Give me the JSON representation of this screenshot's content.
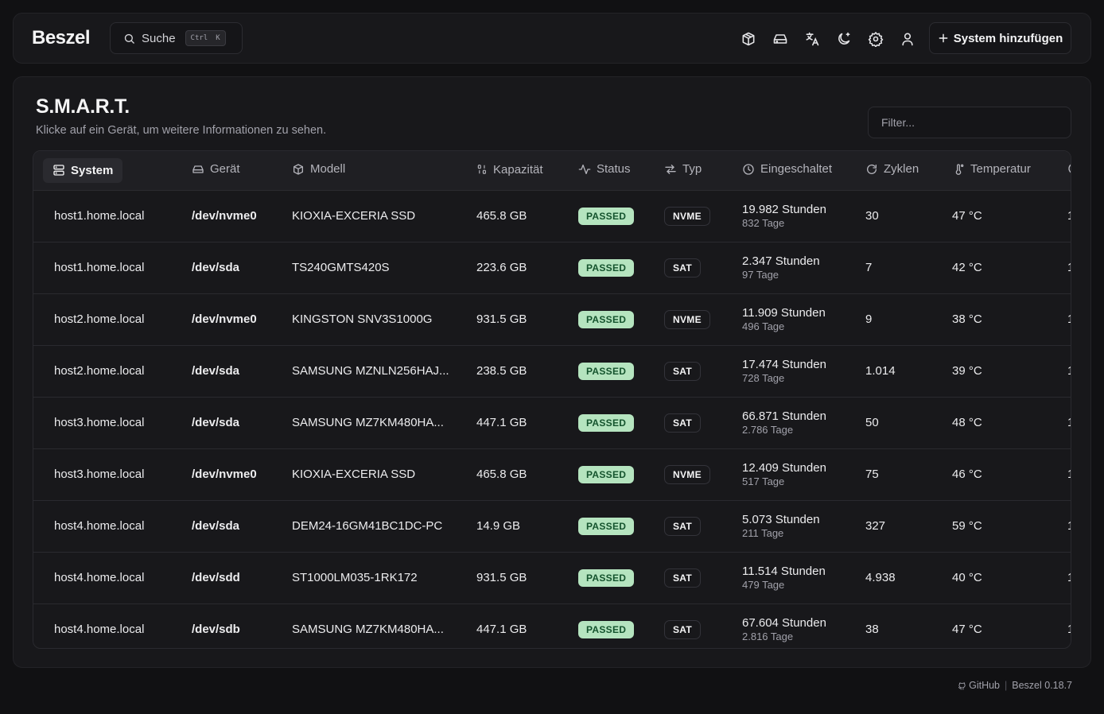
{
  "app": {
    "logo": "Beszel",
    "version": "Beszel 0.18.7"
  },
  "search": {
    "label": "Suche",
    "kbd_1": "Ctrl",
    "kbd_2": "K"
  },
  "header_icons": [
    "container-icon",
    "drive-icon",
    "translate-icon",
    "theme-moon-icon",
    "settings-gear-icon",
    "user-icon"
  ],
  "add_button": "System hinzufügen",
  "page": {
    "title": "S.M.A.R.T.",
    "subtitle": "Klicke auf ein Gerät, um weitere Informationen zu sehen.",
    "filter_placeholder": "Filter..."
  },
  "columns": {
    "system": "System",
    "device": "Gerät",
    "model": "Modell",
    "capacity": "Kapazität",
    "status": "Status",
    "type": "Typ",
    "power_on": "Eingeschaltet",
    "cycles": "Zyklen",
    "temperature": "Temperatur"
  },
  "rows": [
    {
      "system": "host1.home.local",
      "device": "/dev/nvme0",
      "model": "KIOXIA-EXCERIA SSD",
      "capacity": "465.8 GB",
      "status": "PASSED",
      "type": "NVME",
      "hours": "19.982 Stunden",
      "days": "832 Tage",
      "cycles": "30",
      "temp": "47 °C",
      "extra": "1"
    },
    {
      "system": "host1.home.local",
      "device": "/dev/sda",
      "model": "TS240GMTS420S",
      "capacity": "223.6 GB",
      "status": "PASSED",
      "type": "SAT",
      "hours": "2.347 Stunden",
      "days": "97 Tage",
      "cycles": "7",
      "temp": "42 °C",
      "extra": "1"
    },
    {
      "system": "host2.home.local",
      "device": "/dev/nvme0",
      "model": "KINGSTON SNV3S1000G",
      "capacity": "931.5 GB",
      "status": "PASSED",
      "type": "NVME",
      "hours": "11.909 Stunden",
      "days": "496 Tage",
      "cycles": "9",
      "temp": "38 °C",
      "extra": "1"
    },
    {
      "system": "host2.home.local",
      "device": "/dev/sda",
      "model": "SAMSUNG MZNLN256HAJ...",
      "capacity": "238.5 GB",
      "status": "PASSED",
      "type": "SAT",
      "hours": "17.474 Stunden",
      "days": "728 Tage",
      "cycles": "1.014",
      "temp": "39 °C",
      "extra": "1"
    },
    {
      "system": "host3.home.local",
      "device": "/dev/sda",
      "model": "SAMSUNG MZ7KM480HA...",
      "capacity": "447.1 GB",
      "status": "PASSED",
      "type": "SAT",
      "hours": "66.871 Stunden",
      "days": "2.786 Tage",
      "cycles": "50",
      "temp": "48 °C",
      "extra": "1"
    },
    {
      "system": "host3.home.local",
      "device": "/dev/nvme0",
      "model": "KIOXIA-EXCERIA SSD",
      "capacity": "465.8 GB",
      "status": "PASSED",
      "type": "NVME",
      "hours": "12.409 Stunden",
      "days": "517 Tage",
      "cycles": "75",
      "temp": "46 °C",
      "extra": "1"
    },
    {
      "system": "host4.home.local",
      "device": "/dev/sda",
      "model": "DEM24-16GM41BC1DC-PC",
      "capacity": "14.9 GB",
      "status": "PASSED",
      "type": "SAT",
      "hours": "5.073 Stunden",
      "days": "211 Tage",
      "cycles": "327",
      "temp": "59 °C",
      "extra": "1"
    },
    {
      "system": "host4.home.local",
      "device": "/dev/sdd",
      "model": "ST1000LM035-1RK172",
      "capacity": "931.5 GB",
      "status": "PASSED",
      "type": "SAT",
      "hours": "11.514 Stunden",
      "days": "479 Tage",
      "cycles": "4.938",
      "temp": "40 °C",
      "extra": "1"
    },
    {
      "system": "host4.home.local",
      "device": "/dev/sdb",
      "model": "SAMSUNG MZ7KM480HA...",
      "capacity": "447.1 GB",
      "status": "PASSED",
      "type": "SAT",
      "hours": "67.604 Stunden",
      "days": "2.816 Tage",
      "cycles": "38",
      "temp": "47 °C",
      "extra": "1"
    }
  ],
  "footer": {
    "github": "GitHub"
  },
  "colors": {
    "background": "#111113",
    "card": "#18181b",
    "passed_badge": "#b5e4bf",
    "passed_text": "#14532d"
  }
}
